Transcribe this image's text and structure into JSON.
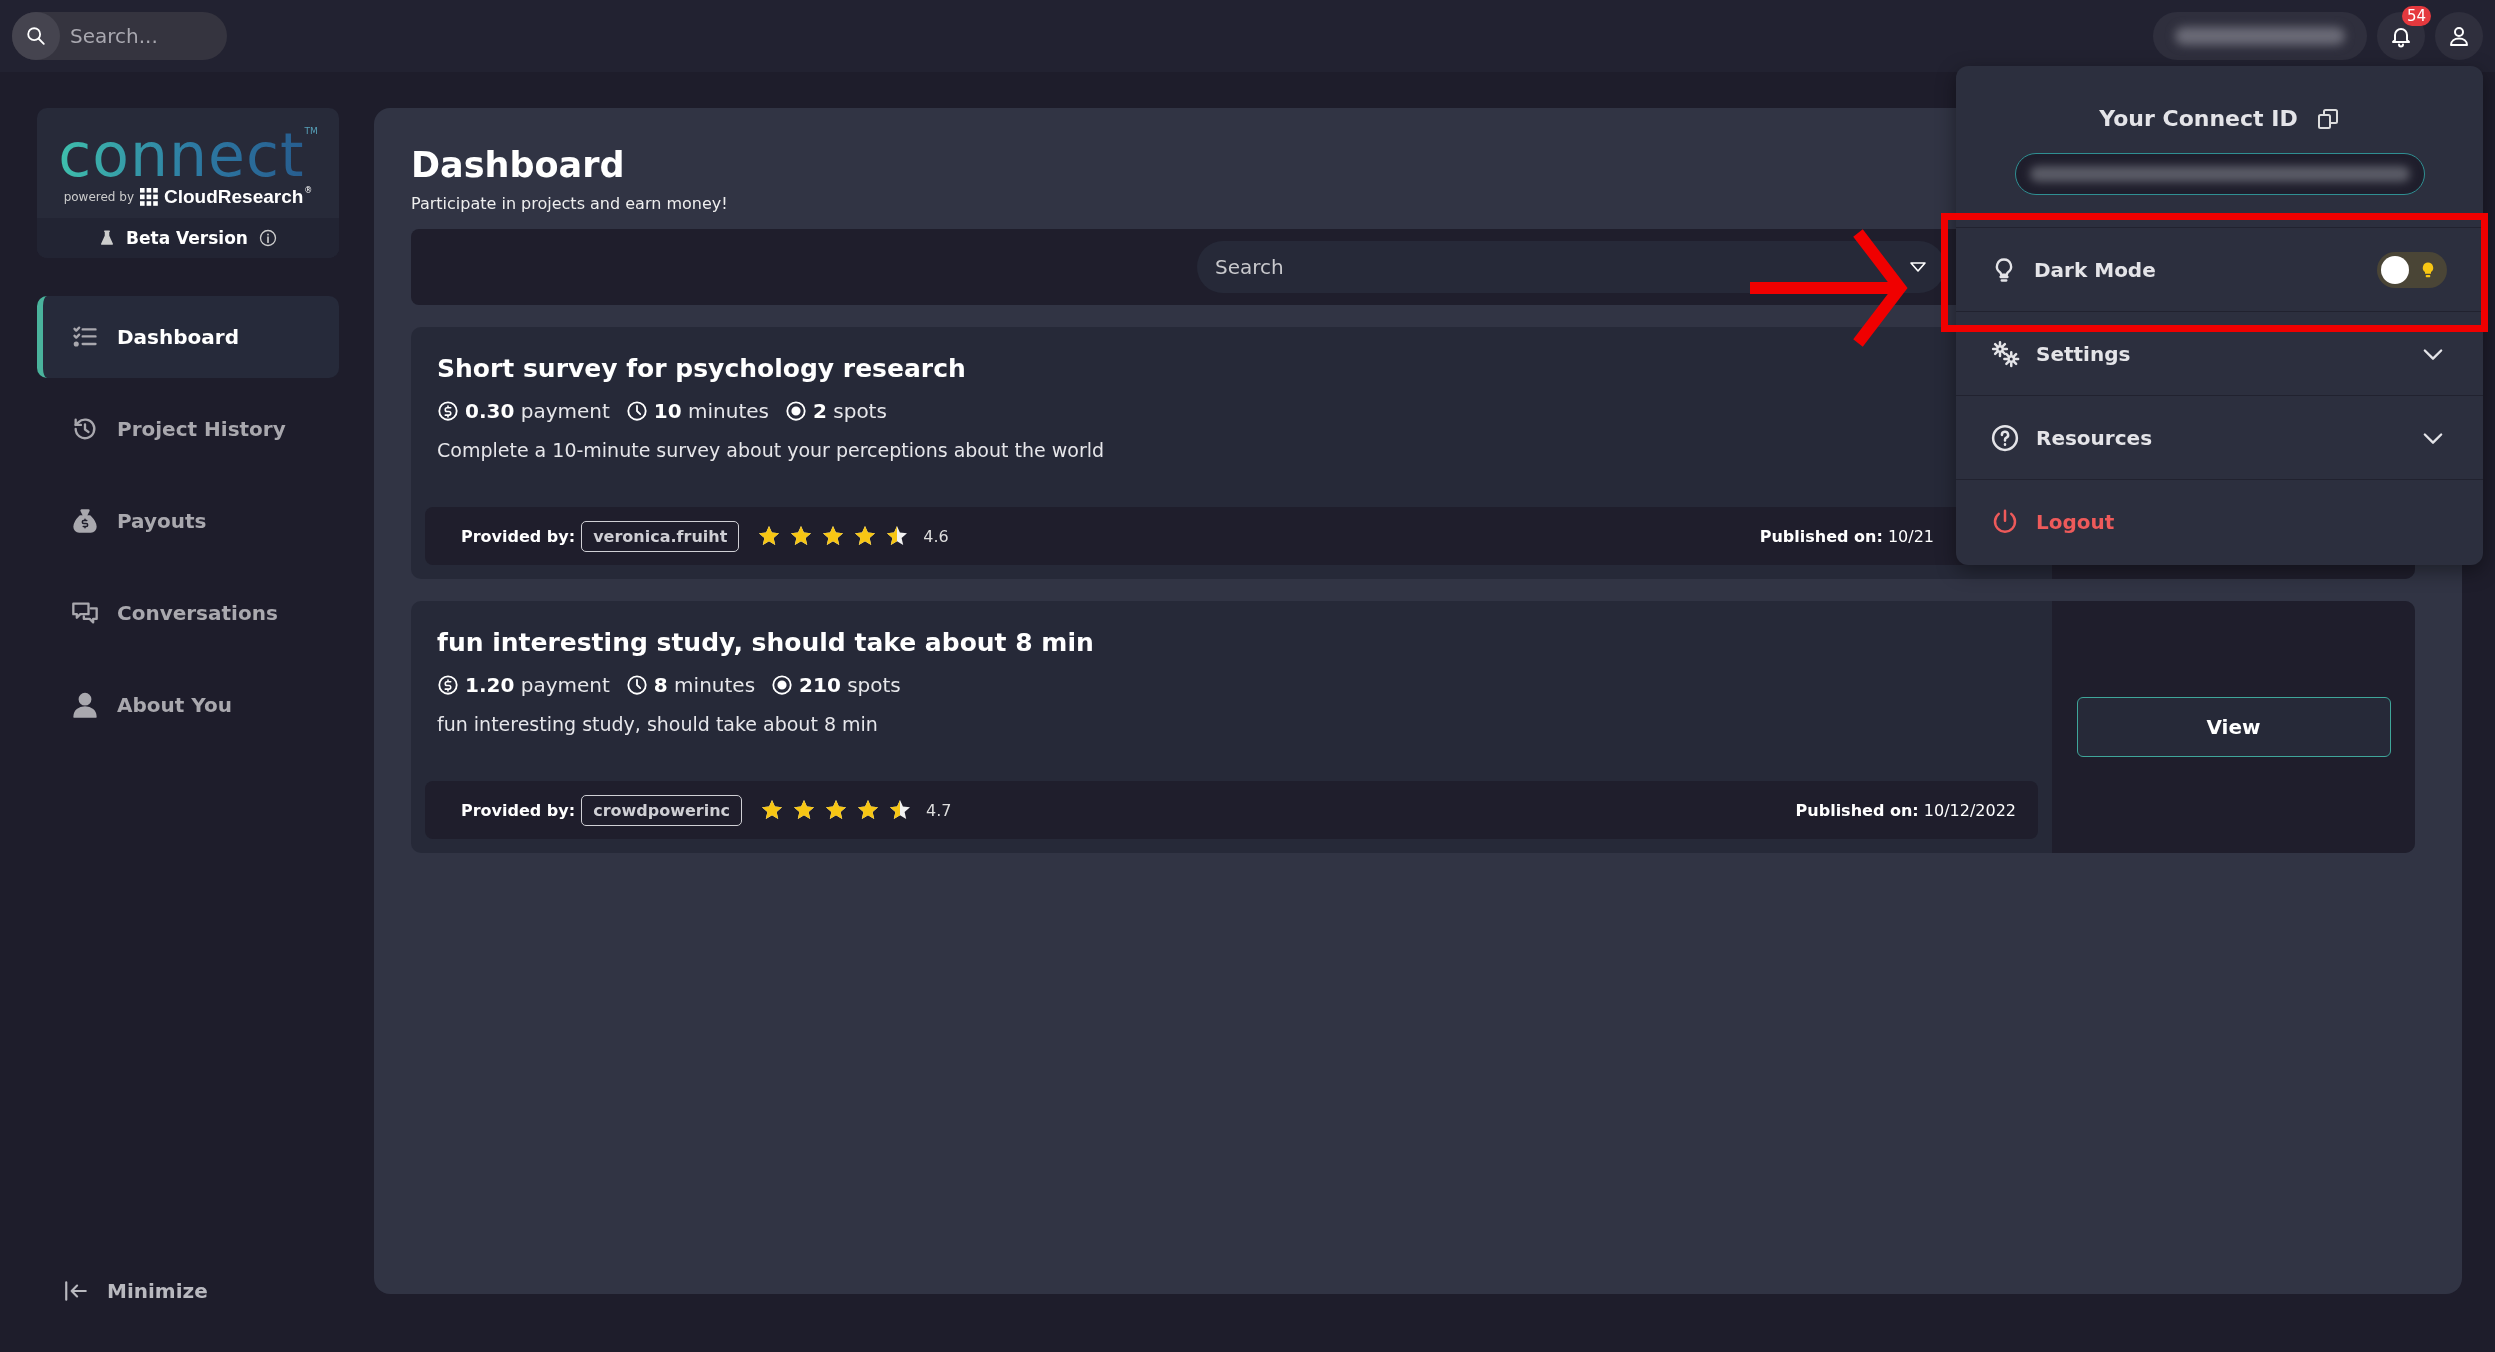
{
  "search": {
    "placeholder": "Search..."
  },
  "header": {
    "notifications": "54"
  },
  "logo": {
    "wordmark": "connect",
    "trademark": "TM",
    "powered_by": "powered by",
    "brand": "CloudResearch",
    "registered": "®",
    "beta": "Beta Version"
  },
  "sidebar": {
    "items": [
      {
        "label": "Dashboard",
        "selected": true
      },
      {
        "label": "Project History",
        "selected": false
      },
      {
        "label": "Payouts",
        "selected": false
      },
      {
        "label": "Conversations",
        "selected": false
      },
      {
        "label": "About You",
        "selected": false
      }
    ],
    "minimize": "Minimize"
  },
  "page": {
    "title": "Dashboard",
    "subtitle": "Participate in projects and earn money!"
  },
  "filters": {
    "search": {
      "placeholder": "Search"
    }
  },
  "projects": [
    {
      "title": "Short survey for psychology research",
      "meta": [
        "**0.30** payment",
        "**10** minutes",
        "**2** spots"
      ],
      "description": "Complete a 10-minute survey about your perceptions about the world",
      "provided_by_label": "Provided by:",
      "provider": "veronica.fruiht",
      "stars": 4.5,
      "rating": "4.6",
      "published_label": "Published on:",
      "published": "10/21"
    },
    {
      "title": "fun interesting study, should take about 8 min",
      "meta": [
        "**1.20** payment",
        "**8** minutes",
        "**210** spots"
      ],
      "description": "fun interesting study, should take about 8 min",
      "provided_by_label": "Provided by:",
      "provider": "crowdpowerinc",
      "stars": 4.5,
      "rating": "4.7",
      "published_label": "Published on:",
      "published": "10/12/2022",
      "button": "View"
    }
  ],
  "account_menu": {
    "title": "Your Connect ID",
    "items": [
      {
        "kind": "toggle",
        "label": "Dark Mode",
        "on": false
      },
      {
        "kind": "submenu",
        "label": "Settings",
        "expanded": false
      },
      {
        "kind": "submenu",
        "label": "Resources",
        "expanded": false
      },
      {
        "kind": "logout",
        "label": "Logout"
      }
    ]
  }
}
